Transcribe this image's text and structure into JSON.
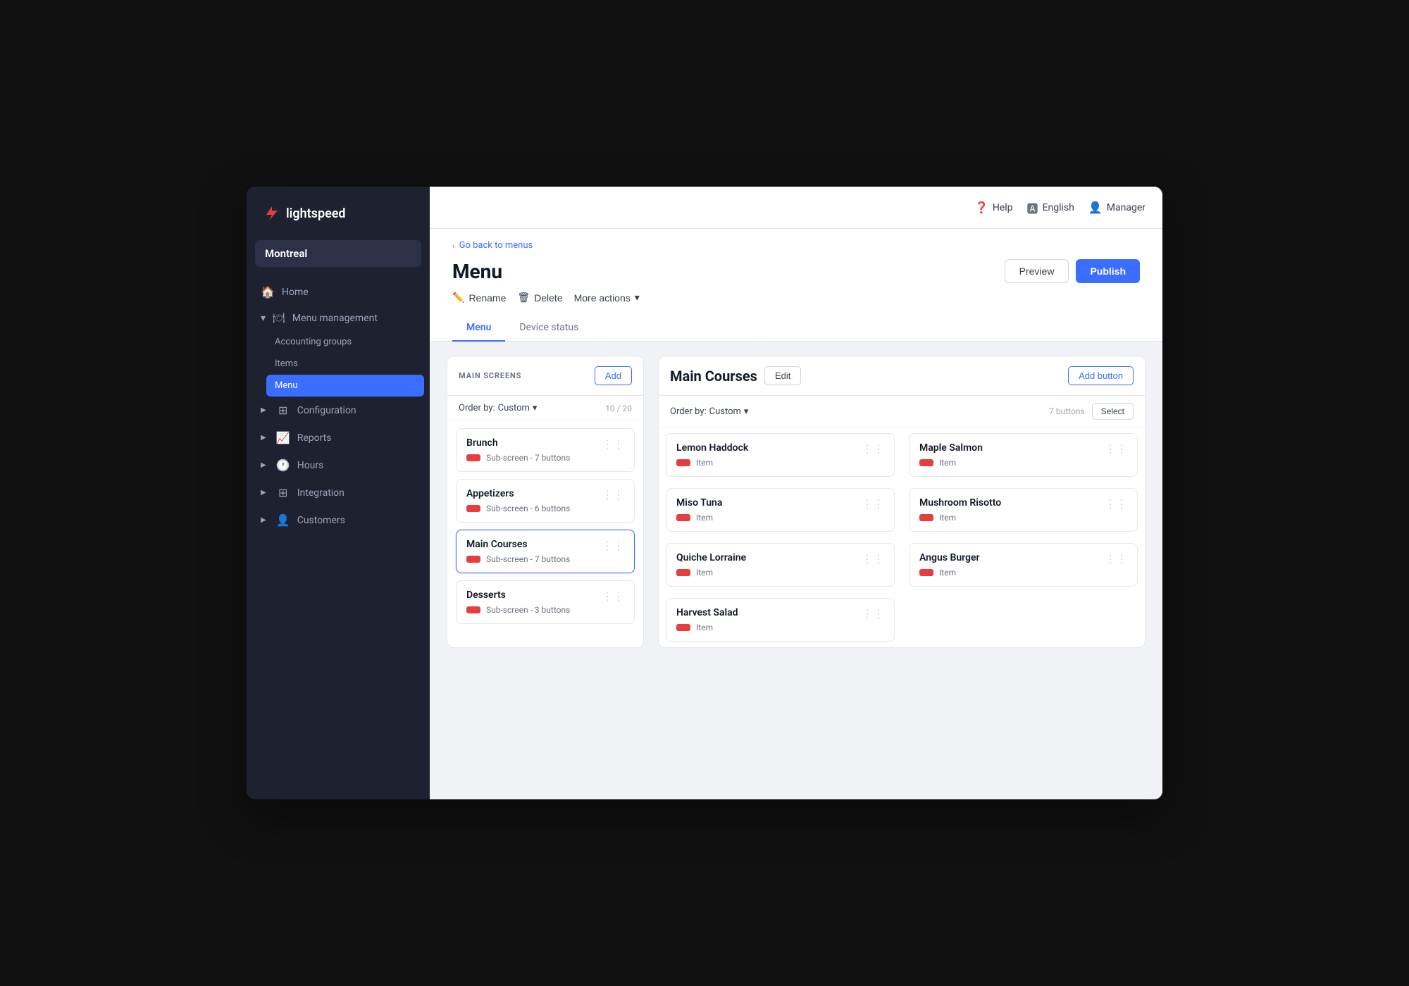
{
  "app": {
    "name": "lightspeed"
  },
  "topbar": {
    "help_label": "Help",
    "language_label": "English",
    "user_label": "Manager"
  },
  "sidebar": {
    "location": "Montreal",
    "nav_items": [
      {
        "id": "home",
        "label": "Home",
        "icon": "🏠",
        "active": false
      },
      {
        "id": "menu-management",
        "label": "Menu management",
        "icon": "🍽",
        "active": false,
        "expanded": true
      },
      {
        "id": "accounting-groups",
        "label": "Accounting groups",
        "active": false,
        "sub": true
      },
      {
        "id": "items",
        "label": "Items",
        "active": false,
        "sub": true
      },
      {
        "id": "menu",
        "label": "Menu",
        "active": true,
        "sub": true
      },
      {
        "id": "configuration",
        "label": "Configuration",
        "icon": "⊞",
        "active": false
      },
      {
        "id": "reports",
        "label": "Reports",
        "icon": "📈",
        "active": false
      },
      {
        "id": "hours",
        "label": "Hours",
        "icon": "🕐",
        "active": false
      },
      {
        "id": "integration",
        "label": "Integration",
        "icon": "⊞",
        "active": false
      },
      {
        "id": "customers",
        "label": "Customers",
        "icon": "👤",
        "active": false
      }
    ]
  },
  "breadcrumb": {
    "text": "Go back to menus",
    "arrow": "‹"
  },
  "page": {
    "title": "Menu",
    "preview_btn": "Preview",
    "publish_btn": "Publish",
    "rename_btn": "Rename",
    "delete_btn": "Delete",
    "more_actions_btn": "More actions"
  },
  "tabs": [
    {
      "id": "menu",
      "label": "Menu",
      "active": true
    },
    {
      "id": "device-status",
      "label": "Device status",
      "active": false
    }
  ],
  "left_column": {
    "title": "MAIN SCREENS",
    "add_btn": "Add",
    "order_label": "Order by:",
    "order_value": "Custom",
    "count": "10 / 20",
    "items": [
      {
        "name": "Brunch",
        "sub": "Sub-screen - 7 buttons"
      },
      {
        "name": "Appetizers",
        "sub": "Sub-screen - 6 buttons"
      },
      {
        "name": "Main Courses",
        "sub": "Sub-screen - 7 buttons",
        "highlighted": true
      },
      {
        "name": "Desserts",
        "sub": "Sub-screen - 3 buttons"
      }
    ]
  },
  "right_column": {
    "title": "Main Courses",
    "edit_btn": "Edit",
    "add_button_btn": "Add button",
    "order_label": "Order by:",
    "order_value": "Custom",
    "count": "7 buttons",
    "select_btn": "Select",
    "items": [
      {
        "name": "Lemon Haddock",
        "sub": "Item"
      },
      {
        "name": "Maple Salmon",
        "sub": "Item"
      },
      {
        "name": "Miso Tuna",
        "sub": "Item"
      },
      {
        "name": "Mushroom Risotto",
        "sub": "Item"
      },
      {
        "name": "Quiche Lorraine",
        "sub": "Item"
      },
      {
        "name": "Angus Burger",
        "sub": "Item"
      },
      {
        "name": "Harvest Salad",
        "sub": "Item"
      }
    ]
  }
}
